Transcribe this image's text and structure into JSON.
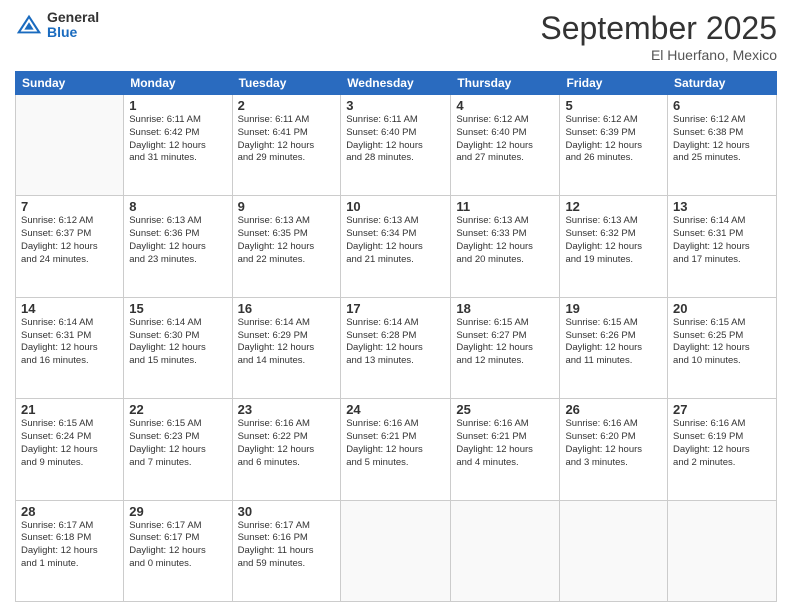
{
  "logo": {
    "general": "General",
    "blue": "Blue"
  },
  "header": {
    "month": "September 2025",
    "location": "El Huerfano, Mexico"
  },
  "weekdays": [
    "Sunday",
    "Monday",
    "Tuesday",
    "Wednesday",
    "Thursday",
    "Friday",
    "Saturday"
  ],
  "weeks": [
    [
      {
        "num": "",
        "info": ""
      },
      {
        "num": "1",
        "info": "Sunrise: 6:11 AM\nSunset: 6:42 PM\nDaylight: 12 hours\nand 31 minutes."
      },
      {
        "num": "2",
        "info": "Sunrise: 6:11 AM\nSunset: 6:41 PM\nDaylight: 12 hours\nand 29 minutes."
      },
      {
        "num": "3",
        "info": "Sunrise: 6:11 AM\nSunset: 6:40 PM\nDaylight: 12 hours\nand 28 minutes."
      },
      {
        "num": "4",
        "info": "Sunrise: 6:12 AM\nSunset: 6:40 PM\nDaylight: 12 hours\nand 27 minutes."
      },
      {
        "num": "5",
        "info": "Sunrise: 6:12 AM\nSunset: 6:39 PM\nDaylight: 12 hours\nand 26 minutes."
      },
      {
        "num": "6",
        "info": "Sunrise: 6:12 AM\nSunset: 6:38 PM\nDaylight: 12 hours\nand 25 minutes."
      }
    ],
    [
      {
        "num": "7",
        "info": "Sunrise: 6:12 AM\nSunset: 6:37 PM\nDaylight: 12 hours\nand 24 minutes."
      },
      {
        "num": "8",
        "info": "Sunrise: 6:13 AM\nSunset: 6:36 PM\nDaylight: 12 hours\nand 23 minutes."
      },
      {
        "num": "9",
        "info": "Sunrise: 6:13 AM\nSunset: 6:35 PM\nDaylight: 12 hours\nand 22 minutes."
      },
      {
        "num": "10",
        "info": "Sunrise: 6:13 AM\nSunset: 6:34 PM\nDaylight: 12 hours\nand 21 minutes."
      },
      {
        "num": "11",
        "info": "Sunrise: 6:13 AM\nSunset: 6:33 PM\nDaylight: 12 hours\nand 20 minutes."
      },
      {
        "num": "12",
        "info": "Sunrise: 6:13 AM\nSunset: 6:32 PM\nDaylight: 12 hours\nand 19 minutes."
      },
      {
        "num": "13",
        "info": "Sunrise: 6:14 AM\nSunset: 6:31 PM\nDaylight: 12 hours\nand 17 minutes."
      }
    ],
    [
      {
        "num": "14",
        "info": "Sunrise: 6:14 AM\nSunset: 6:31 PM\nDaylight: 12 hours\nand 16 minutes."
      },
      {
        "num": "15",
        "info": "Sunrise: 6:14 AM\nSunset: 6:30 PM\nDaylight: 12 hours\nand 15 minutes."
      },
      {
        "num": "16",
        "info": "Sunrise: 6:14 AM\nSunset: 6:29 PM\nDaylight: 12 hours\nand 14 minutes."
      },
      {
        "num": "17",
        "info": "Sunrise: 6:14 AM\nSunset: 6:28 PM\nDaylight: 12 hours\nand 13 minutes."
      },
      {
        "num": "18",
        "info": "Sunrise: 6:15 AM\nSunset: 6:27 PM\nDaylight: 12 hours\nand 12 minutes."
      },
      {
        "num": "19",
        "info": "Sunrise: 6:15 AM\nSunset: 6:26 PM\nDaylight: 12 hours\nand 11 minutes."
      },
      {
        "num": "20",
        "info": "Sunrise: 6:15 AM\nSunset: 6:25 PM\nDaylight: 12 hours\nand 10 minutes."
      }
    ],
    [
      {
        "num": "21",
        "info": "Sunrise: 6:15 AM\nSunset: 6:24 PM\nDaylight: 12 hours\nand 9 minutes."
      },
      {
        "num": "22",
        "info": "Sunrise: 6:15 AM\nSunset: 6:23 PM\nDaylight: 12 hours\nand 7 minutes."
      },
      {
        "num": "23",
        "info": "Sunrise: 6:16 AM\nSunset: 6:22 PM\nDaylight: 12 hours\nand 6 minutes."
      },
      {
        "num": "24",
        "info": "Sunrise: 6:16 AM\nSunset: 6:21 PM\nDaylight: 12 hours\nand 5 minutes."
      },
      {
        "num": "25",
        "info": "Sunrise: 6:16 AM\nSunset: 6:21 PM\nDaylight: 12 hours\nand 4 minutes."
      },
      {
        "num": "26",
        "info": "Sunrise: 6:16 AM\nSunset: 6:20 PM\nDaylight: 12 hours\nand 3 minutes."
      },
      {
        "num": "27",
        "info": "Sunrise: 6:16 AM\nSunset: 6:19 PM\nDaylight: 12 hours\nand 2 minutes."
      }
    ],
    [
      {
        "num": "28",
        "info": "Sunrise: 6:17 AM\nSunset: 6:18 PM\nDaylight: 12 hours\nand 1 minute."
      },
      {
        "num": "29",
        "info": "Sunrise: 6:17 AM\nSunset: 6:17 PM\nDaylight: 12 hours\nand 0 minutes."
      },
      {
        "num": "30",
        "info": "Sunrise: 6:17 AM\nSunset: 6:16 PM\nDaylight: 11 hours\nand 59 minutes."
      },
      {
        "num": "",
        "info": ""
      },
      {
        "num": "",
        "info": ""
      },
      {
        "num": "",
        "info": ""
      },
      {
        "num": "",
        "info": ""
      }
    ]
  ]
}
